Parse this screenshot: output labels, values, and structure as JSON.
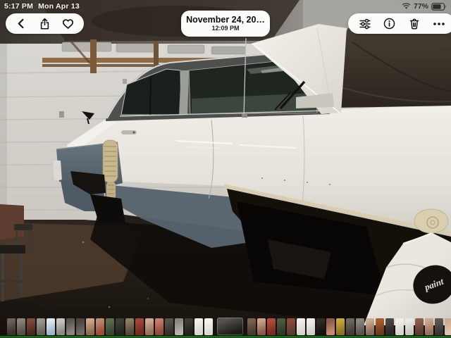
{
  "status_bar": {
    "time": "5:17 PM",
    "date": "Mon Apr 13",
    "battery_percent": "77%",
    "icons": [
      "wifi-icon",
      "battery-icon"
    ]
  },
  "header": {
    "date_title": "November 24, 20…",
    "time_subtitle": "12:09 PM"
  },
  "toolbar_left": {
    "back_icon": "chevron-left",
    "share_icon": "share-up-arrow",
    "favorite_icon": "heart-outline"
  },
  "toolbar_right": {
    "adjust_icon": "sliders",
    "info_icon": "info-circle",
    "delete_icon": "trash",
    "more_icon": "ellipsis"
  },
  "photo": {
    "subject": "classic two-tone car in garage with open trunk lid",
    "bag_logo_text": "paint"
  },
  "colors": {
    "pill_bg": "#fcfcfb",
    "icon_dark": "#1c1c1e",
    "bottom_line_green": "#1d6e1f",
    "car_primer_blue_gray": "#5f6b74",
    "car_body_white": "#e9e7e0"
  },
  "filmstrip": {
    "selected_index": 21,
    "thumbnails": [
      {
        "g": [
          "#6b6158",
          "#3b352d"
        ]
      },
      {
        "g": [
          "#8b8379",
          "#565049"
        ]
      },
      {
        "g": [
          "#7d4a3a",
          "#4a2a20"
        ]
      },
      {
        "g": [
          "#9b968d",
          "#6b665d"
        ]
      },
      {
        "g": [
          "#dfe7f0",
          "#9db6d0"
        ]
      },
      {
        "g": [
          "#c6c6c1",
          "#8b8b86"
        ]
      },
      {
        "g": [
          "#5b564d",
          "#8b867d"
        ]
      },
      {
        "g": [
          "#4b453f",
          "#716b63"
        ]
      },
      {
        "g": [
          "#cba68b",
          "#8b6b53"
        ]
      },
      {
        "g": [
          "#b98b73",
          "#a04a3a"
        ]
      },
      {
        "g": [
          "#5b6b4b",
          "#3b4630"
        ]
      },
      {
        "g": [
          "#3d4036",
          "#24271f"
        ]
      },
      {
        "g": [
          "#8b7b63",
          "#56493b"
        ]
      },
      {
        "g": [
          "#a14539",
          "#712b23"
        ]
      },
      {
        "g": [
          "#cba994",
          "#97715b"
        ]
      },
      {
        "g": [
          "#c67b6b",
          "#8b4b3d"
        ]
      },
      {
        "g": [
          "#56514b",
          "#332f29"
        ]
      },
      {
        "g": [
          "#8b867f",
          "#b9b5ad"
        ]
      },
      {
        "g": [
          "#403b34",
          "#221e19"
        ]
      },
      {
        "g": [
          "#f2f0ea",
          "#d9d6cd"
        ]
      },
      {
        "g": [
          "#f4f2ec",
          "#ddd9d0"
        ]
      },
      {
        "g": [
          "#55524c",
          "#1c1b18"
        ]
      },
      {
        "g": [
          "#75614f",
          "#473b2d"
        ]
      },
      {
        "g": [
          "#cba18b",
          "#8b5b49"
        ]
      },
      {
        "g": [
          "#b14b3d",
          "#7b2b23"
        ]
      },
      {
        "g": [
          "#4b5b3f",
          "#2d3a26"
        ]
      },
      {
        "g": [
          "#8b4b3b",
          "#5b3b2f"
        ]
      },
      {
        "g": [
          "#f0eee8",
          "#d7d4cb"
        ]
      },
      {
        "g": [
          "#efede7",
          "#d4d1c8"
        ]
      },
      {
        "g": [
          "#302c27",
          "#171410"
        ]
      },
      {
        "g": [
          "#8b5b4b",
          "#cb8b73"
        ]
      },
      {
        "g": [
          "#c9a83a",
          "#8b731f"
        ]
      },
      {
        "g": [
          "#6b675f",
          "#413d35"
        ]
      },
      {
        "g": [
          "#8b867d",
          "#5b574f"
        ]
      },
      {
        "g": [
          "#cba994",
          "#8b6b56"
        ]
      },
      {
        "g": [
          "#a85b2b",
          "#6b3b1d"
        ]
      },
      {
        "g": [
          "#4b4641",
          "#2b2723"
        ]
      },
      {
        "g": [
          "#f1efe9",
          "#d7d4ca"
        ]
      },
      {
        "g": [
          "#e9e7e1",
          "#cac7be"
        ]
      },
      {
        "g": [
          "#8b5b4b",
          "#5b3b2f"
        ]
      },
      {
        "g": [
          "#cba68f",
          "#97715d"
        ]
      },
      {
        "g": [
          "#5b564f",
          "#393531"
        ]
      },
      {
        "g": [
          "#cba994",
          "#e1c6af"
        ]
      }
    ]
  }
}
